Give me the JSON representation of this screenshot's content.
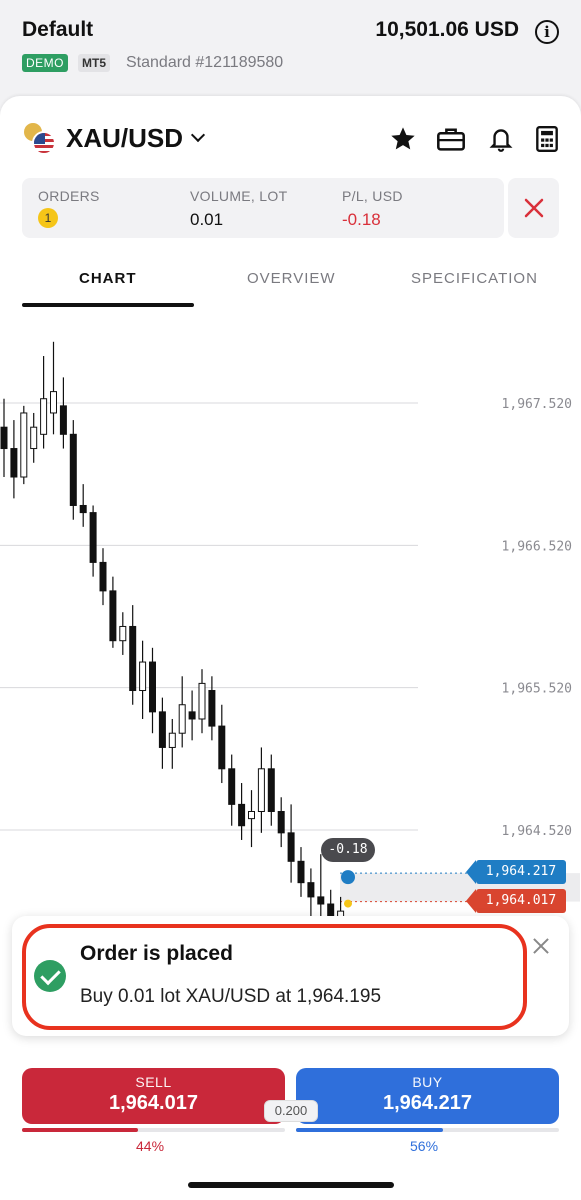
{
  "account": {
    "name": "Default",
    "balance": "10,501.06 USD",
    "badge_demo": "DEMO",
    "badge_platform": "MT5",
    "account_type": "Standard #121189580"
  },
  "symbol": {
    "name": "XAU/USD",
    "icons": [
      "star-icon",
      "briefcase-icon",
      "bell-icon",
      "calculator-icon"
    ]
  },
  "orders_summary": {
    "orders_label": "ORDERS",
    "orders_count": "1",
    "volume_label": "VOLUME, LOT",
    "volume_value": "0.01",
    "pl_label": "P/L, USD",
    "pl_value": "-0.18"
  },
  "tabs": [
    {
      "label": "CHART",
      "active": true
    },
    {
      "label": "OVERVIEW",
      "active": false
    },
    {
      "label": "SPECIFICATION",
      "active": false
    }
  ],
  "chart_data": {
    "type": "candlestick",
    "price_levels": [
      "1,967.520",
      "1,966.520",
      "1,965.520",
      "1,964.520"
    ],
    "level_values": [
      1967.52,
      1966.52,
      1965.52,
      1964.52
    ],
    "buy_price_tag": "1,964.217",
    "sell_price_tag": "1,964.017",
    "position_pl": "-0.18",
    "candles": [
      {
        "o": 1967.35,
        "h": 1967.55,
        "l": 1967.0,
        "c": 1967.2
      },
      {
        "o": 1967.2,
        "h": 1967.4,
        "l": 1966.85,
        "c": 1967.0
      },
      {
        "o": 1967.0,
        "h": 1967.5,
        "l": 1966.95,
        "c": 1967.45
      },
      {
        "o": 1967.2,
        "h": 1967.45,
        "l": 1967.1,
        "c": 1967.35
      },
      {
        "o": 1967.3,
        "h": 1967.85,
        "l": 1967.2,
        "c": 1967.55
      },
      {
        "o": 1967.45,
        "h": 1967.95,
        "l": 1967.3,
        "c": 1967.6
      },
      {
        "o": 1967.5,
        "h": 1967.7,
        "l": 1967.2,
        "c": 1967.3
      },
      {
        "o": 1967.3,
        "h": 1967.4,
        "l": 1966.7,
        "c": 1966.8
      },
      {
        "o": 1966.8,
        "h": 1966.95,
        "l": 1966.65,
        "c": 1966.75
      },
      {
        "o": 1966.75,
        "h": 1966.8,
        "l": 1966.3,
        "c": 1966.4
      },
      {
        "o": 1966.4,
        "h": 1966.5,
        "l": 1966.1,
        "c": 1966.2
      },
      {
        "o": 1966.2,
        "h": 1966.3,
        "l": 1965.8,
        "c": 1965.85
      },
      {
        "o": 1965.85,
        "h": 1966.05,
        "l": 1965.75,
        "c": 1965.95
      },
      {
        "o": 1965.95,
        "h": 1966.1,
        "l": 1965.4,
        "c": 1965.5
      },
      {
        "o": 1965.5,
        "h": 1965.85,
        "l": 1965.3,
        "c": 1965.7
      },
      {
        "o": 1965.7,
        "h": 1965.8,
        "l": 1965.2,
        "c": 1965.35
      },
      {
        "o": 1965.35,
        "h": 1965.45,
        "l": 1964.95,
        "c": 1965.1
      },
      {
        "o": 1965.1,
        "h": 1965.3,
        "l": 1964.95,
        "c": 1965.2
      },
      {
        "o": 1965.2,
        "h": 1965.6,
        "l": 1965.1,
        "c": 1965.4
      },
      {
        "o": 1965.35,
        "h": 1965.5,
        "l": 1965.15,
        "c": 1965.3
      },
      {
        "o": 1965.3,
        "h": 1965.65,
        "l": 1965.2,
        "c": 1965.55
      },
      {
        "o": 1965.5,
        "h": 1965.6,
        "l": 1965.15,
        "c": 1965.25
      },
      {
        "o": 1965.25,
        "h": 1965.4,
        "l": 1964.85,
        "c": 1964.95
      },
      {
        "o": 1964.95,
        "h": 1965.05,
        "l": 1964.55,
        "c": 1964.7
      },
      {
        "o": 1964.7,
        "h": 1964.85,
        "l": 1964.45,
        "c": 1964.55
      },
      {
        "o": 1964.6,
        "h": 1964.8,
        "l": 1964.4,
        "c": 1964.65
      },
      {
        "o": 1964.65,
        "h": 1965.1,
        "l": 1964.5,
        "c": 1964.95
      },
      {
        "o": 1964.95,
        "h": 1965.05,
        "l": 1964.55,
        "c": 1964.65
      },
      {
        "o": 1964.65,
        "h": 1964.75,
        "l": 1964.4,
        "c": 1964.5
      },
      {
        "o": 1964.5,
        "h": 1964.7,
        "l": 1964.15,
        "c": 1964.3
      },
      {
        "o": 1964.3,
        "h": 1964.4,
        "l": 1964.05,
        "c": 1964.15
      },
      {
        "o": 1964.15,
        "h": 1964.25,
        "l": 1963.9,
        "c": 1964.05
      },
      {
        "o": 1964.05,
        "h": 1964.35,
        "l": 1963.8,
        "c": 1964.0
      },
      {
        "o": 1964.0,
        "h": 1964.1,
        "l": 1963.85,
        "c": 1963.9
      },
      {
        "o": 1963.9,
        "h": 1964.05,
        "l": 1963.75,
        "c": 1963.95
      }
    ]
  },
  "toast": {
    "title": "Order is placed",
    "message": "Buy 0.01 lot XAU/USD at 1,964.195"
  },
  "trade": {
    "sell_label": "SELL",
    "sell_price": "1,964.017",
    "buy_label": "BUY",
    "buy_price": "1,964.217",
    "spread": "0.200",
    "sell_pct": "44%",
    "buy_pct": "56%",
    "sell_ratio": 0.44,
    "buy_ratio": 0.56,
    "sell_color": "#c9283a",
    "buy_color": "#2f6fdb"
  }
}
